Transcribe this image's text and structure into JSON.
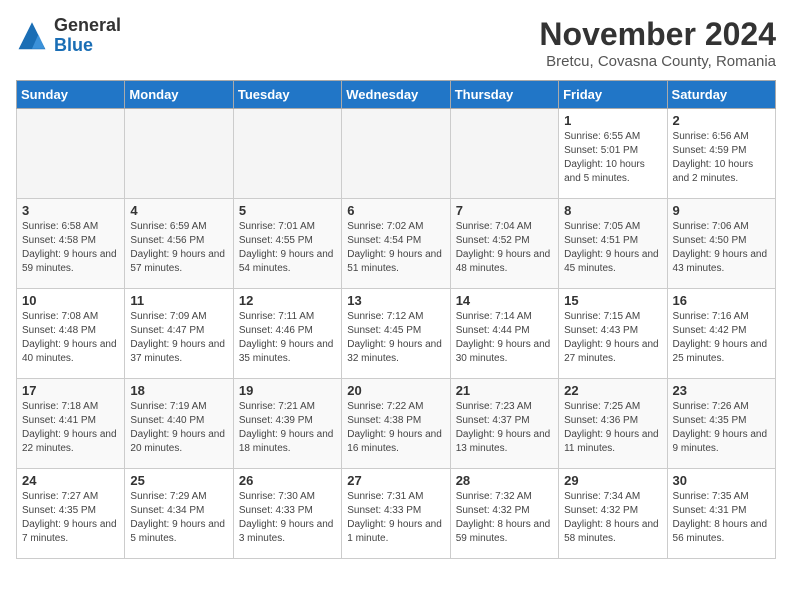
{
  "header": {
    "logo_general": "General",
    "logo_blue": "Blue",
    "month_title": "November 2024",
    "location": "Bretcu, Covasna County, Romania"
  },
  "weekdays": [
    "Sunday",
    "Monday",
    "Tuesday",
    "Wednesday",
    "Thursday",
    "Friday",
    "Saturday"
  ],
  "weeks": [
    [
      {
        "day": "",
        "info": ""
      },
      {
        "day": "",
        "info": ""
      },
      {
        "day": "",
        "info": ""
      },
      {
        "day": "",
        "info": ""
      },
      {
        "day": "",
        "info": ""
      },
      {
        "day": "1",
        "info": "Sunrise: 6:55 AM\nSunset: 5:01 PM\nDaylight: 10 hours and 5 minutes."
      },
      {
        "day": "2",
        "info": "Sunrise: 6:56 AM\nSunset: 4:59 PM\nDaylight: 10 hours and 2 minutes."
      }
    ],
    [
      {
        "day": "3",
        "info": "Sunrise: 6:58 AM\nSunset: 4:58 PM\nDaylight: 9 hours and 59 minutes."
      },
      {
        "day": "4",
        "info": "Sunrise: 6:59 AM\nSunset: 4:56 PM\nDaylight: 9 hours and 57 minutes."
      },
      {
        "day": "5",
        "info": "Sunrise: 7:01 AM\nSunset: 4:55 PM\nDaylight: 9 hours and 54 minutes."
      },
      {
        "day": "6",
        "info": "Sunrise: 7:02 AM\nSunset: 4:54 PM\nDaylight: 9 hours and 51 minutes."
      },
      {
        "day": "7",
        "info": "Sunrise: 7:04 AM\nSunset: 4:52 PM\nDaylight: 9 hours and 48 minutes."
      },
      {
        "day": "8",
        "info": "Sunrise: 7:05 AM\nSunset: 4:51 PM\nDaylight: 9 hours and 45 minutes."
      },
      {
        "day": "9",
        "info": "Sunrise: 7:06 AM\nSunset: 4:50 PM\nDaylight: 9 hours and 43 minutes."
      }
    ],
    [
      {
        "day": "10",
        "info": "Sunrise: 7:08 AM\nSunset: 4:48 PM\nDaylight: 9 hours and 40 minutes."
      },
      {
        "day": "11",
        "info": "Sunrise: 7:09 AM\nSunset: 4:47 PM\nDaylight: 9 hours and 37 minutes."
      },
      {
        "day": "12",
        "info": "Sunrise: 7:11 AM\nSunset: 4:46 PM\nDaylight: 9 hours and 35 minutes."
      },
      {
        "day": "13",
        "info": "Sunrise: 7:12 AM\nSunset: 4:45 PM\nDaylight: 9 hours and 32 minutes."
      },
      {
        "day": "14",
        "info": "Sunrise: 7:14 AM\nSunset: 4:44 PM\nDaylight: 9 hours and 30 minutes."
      },
      {
        "day": "15",
        "info": "Sunrise: 7:15 AM\nSunset: 4:43 PM\nDaylight: 9 hours and 27 minutes."
      },
      {
        "day": "16",
        "info": "Sunrise: 7:16 AM\nSunset: 4:42 PM\nDaylight: 9 hours and 25 minutes."
      }
    ],
    [
      {
        "day": "17",
        "info": "Sunrise: 7:18 AM\nSunset: 4:41 PM\nDaylight: 9 hours and 22 minutes."
      },
      {
        "day": "18",
        "info": "Sunrise: 7:19 AM\nSunset: 4:40 PM\nDaylight: 9 hours and 20 minutes."
      },
      {
        "day": "19",
        "info": "Sunrise: 7:21 AM\nSunset: 4:39 PM\nDaylight: 9 hours and 18 minutes."
      },
      {
        "day": "20",
        "info": "Sunrise: 7:22 AM\nSunset: 4:38 PM\nDaylight: 9 hours and 16 minutes."
      },
      {
        "day": "21",
        "info": "Sunrise: 7:23 AM\nSunset: 4:37 PM\nDaylight: 9 hours and 13 minutes."
      },
      {
        "day": "22",
        "info": "Sunrise: 7:25 AM\nSunset: 4:36 PM\nDaylight: 9 hours and 11 minutes."
      },
      {
        "day": "23",
        "info": "Sunrise: 7:26 AM\nSunset: 4:35 PM\nDaylight: 9 hours and 9 minutes."
      }
    ],
    [
      {
        "day": "24",
        "info": "Sunrise: 7:27 AM\nSunset: 4:35 PM\nDaylight: 9 hours and 7 minutes."
      },
      {
        "day": "25",
        "info": "Sunrise: 7:29 AM\nSunset: 4:34 PM\nDaylight: 9 hours and 5 minutes."
      },
      {
        "day": "26",
        "info": "Sunrise: 7:30 AM\nSunset: 4:33 PM\nDaylight: 9 hours and 3 minutes."
      },
      {
        "day": "27",
        "info": "Sunrise: 7:31 AM\nSunset: 4:33 PM\nDaylight: 9 hours and 1 minute."
      },
      {
        "day": "28",
        "info": "Sunrise: 7:32 AM\nSunset: 4:32 PM\nDaylight: 8 hours and 59 minutes."
      },
      {
        "day": "29",
        "info": "Sunrise: 7:34 AM\nSunset: 4:32 PM\nDaylight: 8 hours and 58 minutes."
      },
      {
        "day": "30",
        "info": "Sunrise: 7:35 AM\nSunset: 4:31 PM\nDaylight: 8 hours and 56 minutes."
      }
    ]
  ]
}
